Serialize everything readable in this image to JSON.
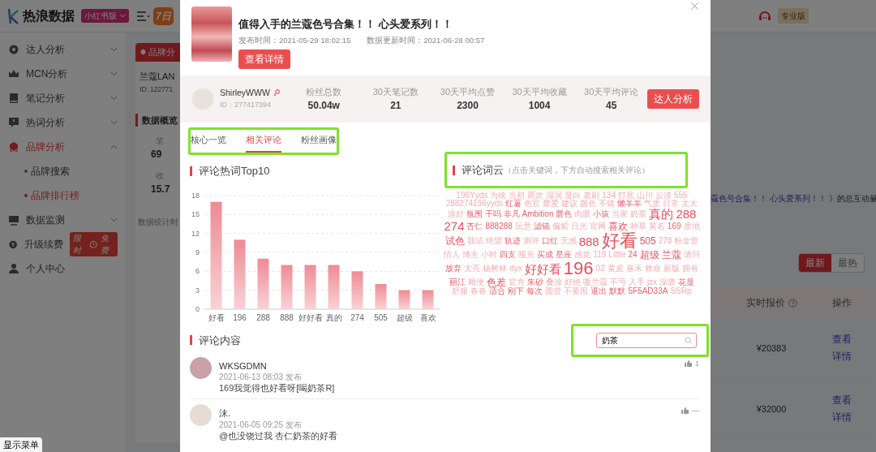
{
  "app": {
    "logo_text": "热浪数据",
    "platform_badge": "小红书版",
    "promo_button": "7日",
    "plan_badge": "专业版"
  },
  "sidebar": {
    "items": [
      {
        "label": "达人分析",
        "kind": "group",
        "expanded": false,
        "selected": false
      },
      {
        "label": "MCN分析",
        "kind": "group",
        "expanded": false,
        "selected": false
      },
      {
        "label": "笔记分析",
        "kind": "group",
        "expanded": false,
        "selected": false
      },
      {
        "label": "热词分析",
        "kind": "group",
        "expanded": false,
        "selected": false
      },
      {
        "label": "品牌分析",
        "kind": "group",
        "expanded": true,
        "selected": true,
        "children": [
          {
            "label": "品牌搜索",
            "selected": false
          },
          {
            "label": "品牌排行榜",
            "selected": true
          }
        ]
      },
      {
        "label": "数据监测",
        "kind": "group",
        "expanded": false,
        "selected": false
      },
      {
        "label": "升级续费",
        "kind": "link",
        "selected": false,
        "promo_badge": {
          "left": "限时",
          "right": "免费"
        }
      },
      {
        "label": "个人中心",
        "kind": "link",
        "selected": false
      }
    ]
  },
  "background_page": {
    "brand_tab": "品牌分",
    "brand_name": "兰蔻LAN",
    "brand_id": "ID: 122771",
    "overview_title": "数据概览",
    "stats": [
      {
        "label": "笔",
        "value": "69"
      },
      {
        "label": "收",
        "value": "15.7"
      }
    ],
    "stat_note": "数据统计时",
    "post_link": "蔻色号合集！！ 心头爱系列！！ 》",
    "post_suffix": "的总互动量",
    "sort_toggle": [
      {
        "label": "最新",
        "selected": true
      },
      {
        "label": "最热",
        "selected": false
      }
    ],
    "table": {
      "columns": [
        "实时报价",
        "操作"
      ],
      "rows": [
        {
          "price": "¥20383",
          "action": "查看详情"
        },
        {
          "price": "¥32000",
          "action": "查看详情"
        }
      ]
    }
  },
  "show_menu_button": "显示菜单",
  "modal": {
    "post": {
      "title": "值得入手的兰蔻色号合集！！ 心头爱系列！！",
      "published": "发布时间：2021-05-29 18:02:15",
      "updated": "数据更新时间：2021-06-28 00:57",
      "view_button": "查看详情"
    },
    "author": {
      "name": "ShirleyWWW",
      "id": "ID：277417394",
      "stats": [
        {
          "label": "粉丝总数",
          "value": "50.04w"
        },
        {
          "label": "30天笔记数",
          "value": "21"
        },
        {
          "label": "30天平均点赞",
          "value": "2300"
        },
        {
          "label": "30天平均收藏",
          "value": "1004"
        },
        {
          "label": "30天平均评论",
          "value": "45"
        }
      ],
      "button": "达人分析"
    },
    "tab_bar": {
      "highlighted": true,
      "tabs": [
        {
          "label": "核心一览",
          "selected": false
        },
        {
          "label": "相关评论",
          "selected": true
        },
        {
          "label": "粉丝画像",
          "selected": false
        }
      ]
    },
    "hot_words": {
      "title": "评论热词Top10",
      "chart_data": {
        "type": "bar",
        "categories": [
          "好看",
          "196",
          "288",
          "888",
          "好好看",
          "真的",
          "274",
          "505",
          "超级",
          "喜欢"
        ],
        "values": [
          17,
          11,
          8,
          7,
          7,
          7,
          6,
          4,
          3,
          3
        ],
        "ylim": [
          0,
          18
        ],
        "yticks": [
          0,
          3,
          6,
          9,
          12,
          15,
          18
        ],
        "grid": true
      }
    },
    "word_cloud": {
      "title": "评论词云",
      "hint": "（点击关键词，下方自动搜索相关评论）",
      "highlighted": true,
      "words": [
        {
          "text": "196Yyds",
          "kind": "faint"
        },
        {
          "text": "为啥",
          "kind": "faint"
        },
        {
          "text": "当初",
          "kind": "faint"
        },
        {
          "text": "两次",
          "kind": "faint"
        },
        {
          "text": "湿润",
          "kind": "faint"
        },
        {
          "text": "显白",
          "kind": "faint"
        },
        {
          "text": "老刷",
          "kind": "faint"
        },
        {
          "text": "134",
          "kind": "faint"
        },
        {
          "text": "打底",
          "kind": "faint"
        },
        {
          "text": "山川",
          "kind": "faint"
        },
        {
          "text": "云淡",
          "kind": "faint"
        },
        {
          "text": "555",
          "kind": "faint"
        },
        {
          "text": "288274196yyds",
          "kind": "faint"
        },
        {
          "text": "红薯",
          "kind": "small"
        },
        {
          "text": "色官",
          "kind": "faint"
        },
        {
          "text": "最爱",
          "kind": "faint"
        },
        {
          "text": "建议",
          "kind": "faint"
        },
        {
          "text": "颜色",
          "kind": "faint"
        },
        {
          "text": "不错",
          "kind": "faint"
        },
        {
          "text": "懒羊羊",
          "kind": "small"
        },
        {
          "text": "气质",
          "kind": "faint"
        },
        {
          "text": "日常",
          "kind": "faint"
        },
        {
          "text": "太大",
          "kind": "faint"
        },
        {
          "text": "涂好",
          "kind": "faint"
        },
        {
          "text": "氛围",
          "kind": "small"
        },
        {
          "text": "干吗",
          "kind": "small"
        },
        {
          "text": "非凡",
          "kind": "small"
        },
        {
          "text": "Ambition",
          "kind": "small"
        },
        {
          "text": "唇色",
          "kind": "small"
        },
        {
          "text": "肉眼",
          "kind": "faint"
        },
        {
          "text": "小孩",
          "kind": "small"
        },
        {
          "text": "当家",
          "kind": "faint"
        },
        {
          "text": "奶茶",
          "kind": "faint"
        },
        {
          "text": "真的",
          "kind": "big"
        },
        {
          "text": "288",
          "kind": "big"
        },
        {
          "text": "274",
          "kind": "big"
        },
        {
          "text": "杏仁",
          "kind": "small"
        },
        {
          "text": "888288",
          "kind": "small"
        },
        {
          "text": "玩意",
          "kind": "faint"
        },
        {
          "text": "滤镜",
          "kind": "small"
        },
        {
          "text": "偏紫",
          "kind": "faint"
        },
        {
          "text": "日光",
          "kind": "faint"
        },
        {
          "text": "官网",
          "kind": "faint"
        },
        {
          "text": "喜欢",
          "kind": "medium"
        },
        {
          "text": "种草",
          "kind": "faint"
        },
        {
          "text": "莫名",
          "kind": "faint"
        },
        {
          "text": "169",
          "kind": "small"
        },
        {
          "text": "质地",
          "kind": "faint"
        },
        {
          "text": "试色",
          "kind": "medium"
        },
        {
          "text": "我试",
          "kind": "faint"
        },
        {
          "text": "绝望",
          "kind": "faint"
        },
        {
          "text": "轨迹",
          "kind": "small"
        },
        {
          "text": "测评",
          "kind": "faint"
        },
        {
          "text": "口红",
          "kind": "small"
        },
        {
          "text": "无感",
          "kind": "faint"
        },
        {
          "text": "888",
          "kind": "big"
        },
        {
          "text": "好看",
          "kind": "huge"
        },
        {
          "text": "505",
          "kind": "medium"
        },
        {
          "text": "278",
          "kind": "faint"
        },
        {
          "text": "粉金管",
          "kind": "faint"
        },
        {
          "text": "情人",
          "kind": "faint"
        },
        {
          "text": "博主",
          "kind": "faint"
        },
        {
          "text": "小时",
          "kind": "faint"
        },
        {
          "text": "四支",
          "kind": "small"
        },
        {
          "text": "哑光",
          "kind": "faint"
        },
        {
          "text": "买成",
          "kind": "small"
        },
        {
          "text": "星座",
          "kind": "small"
        },
        {
          "text": "感觉",
          "kind": "faint"
        },
        {
          "text": "119",
          "kind": "faint"
        },
        {
          "text": "Little",
          "kind": "faint"
        },
        {
          "text": "24",
          "kind": "small"
        },
        {
          "text": "超级",
          "kind": "medium"
        },
        {
          "text": "兰蔻",
          "kind": "medium"
        },
        {
          "text": "请问",
          "kind": "faint"
        },
        {
          "text": "放弃",
          "kind": "small"
        },
        {
          "text": "太亮",
          "kind": "faint"
        },
        {
          "text": "杨树林",
          "kind": "faint"
        },
        {
          "text": "dyx",
          "kind": "faint"
        },
        {
          "text": "好好看",
          "kind": "big"
        },
        {
          "text": "196",
          "kind": "huge"
        },
        {
          "text": "02",
          "kind": "faint"
        },
        {
          "text": "黄皮",
          "kind": "faint"
        },
        {
          "text": "嘉禾",
          "kind": "faint"
        },
        {
          "text": "救命",
          "kind": "faint"
        },
        {
          "text": "新版",
          "kind": "faint"
        },
        {
          "text": "拥有",
          "kind": "faint"
        },
        {
          "text": "丽江",
          "kind": "small"
        },
        {
          "text": "顺便",
          "kind": "faint"
        },
        {
          "text": "色差",
          "kind": "medium"
        },
        {
          "text": "官方",
          "kind": "faint"
        },
        {
          "text": "朱砂",
          "kind": "small"
        },
        {
          "text": "叠涂",
          "kind": "faint"
        },
        {
          "text": "好绝",
          "kind": "faint"
        },
        {
          "text": "嗷兰蔻",
          "kind": "faint"
        },
        {
          "text": "不亏",
          "kind": "faint"
        },
        {
          "text": "入手",
          "kind": "faint"
        },
        {
          "text": "jzx",
          "kind": "faint"
        },
        {
          "text": "深唇",
          "kind": "faint"
        },
        {
          "text": "花显",
          "kind": "small"
        },
        {
          "text": "舒服",
          "kind": "faint"
        },
        {
          "text": "春春",
          "kind": "faint"
        },
        {
          "text": "适合",
          "kind": "small"
        },
        {
          "text": "刚下",
          "kind": "small"
        },
        {
          "text": "每次",
          "kind": "small"
        },
        {
          "text": "圆管",
          "kind": "faint"
        },
        {
          "text": "不要囤",
          "kind": "faint"
        },
        {
          "text": "退出",
          "kind": "small"
        },
        {
          "text": "默默",
          "kind": "small"
        },
        {
          "text": "5F5AD33A",
          "kind": "small"
        },
        {
          "text": "SSRp",
          "kind": "faint"
        }
      ]
    },
    "comments": {
      "title": "评论内容",
      "search": {
        "value": "奶茶",
        "highlighted": true
      },
      "items": [
        {
          "user": "WKSGDMN",
          "date": "2021-06-13 08:03 发布",
          "text": "169我觉得也好看呀[喝奶茶R]",
          "likes": "1"
        },
        {
          "user": "沫.",
          "date": "2021-06-05 09:25 发布",
          "text": "@也没饶过我 杏仁奶茶的好看",
          "likes": "—"
        }
      ]
    }
  }
}
